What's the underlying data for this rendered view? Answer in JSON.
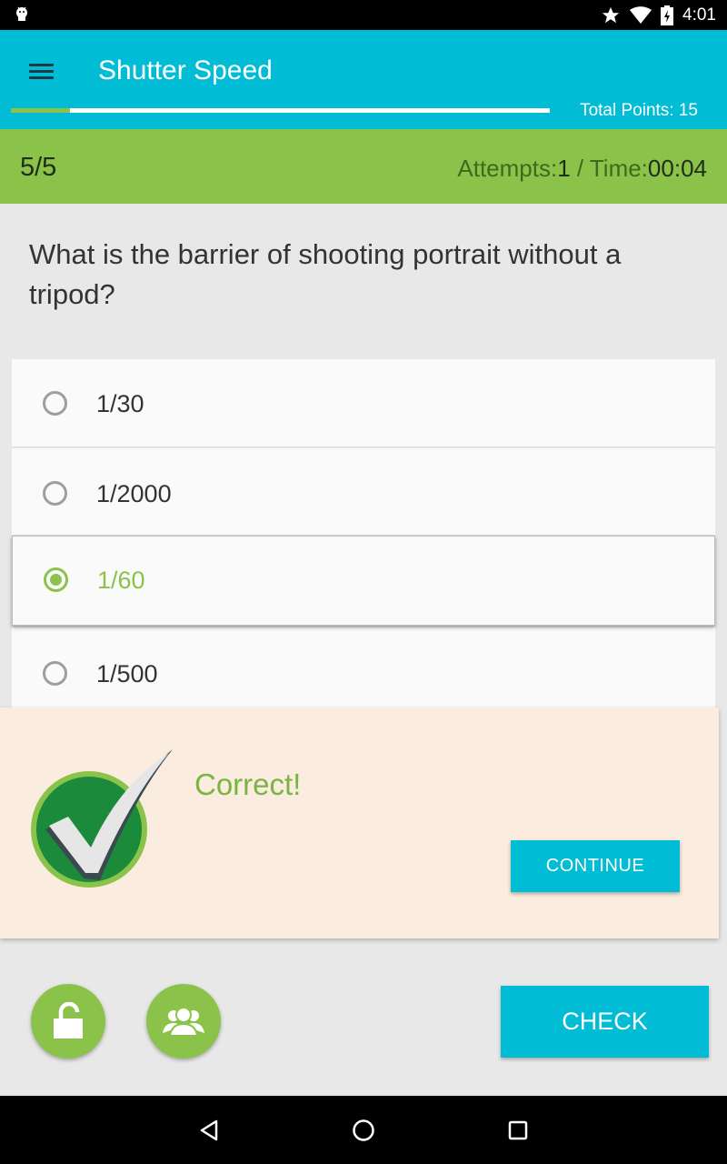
{
  "status_bar": {
    "time": "4:01",
    "icons": [
      "android-icon",
      "star-icon",
      "wifi-icon",
      "battery-icon"
    ]
  },
  "app_bar": {
    "title": "Shutter Speed",
    "total_points_label": "Total Points: 15",
    "progress_fraction": 0.11,
    "color": "#00bcd4"
  },
  "quiz_status": {
    "question_counter": "5/5",
    "attempts_label": "Attempts:",
    "attempts_value": "1",
    "separator": " / ",
    "time_label": "Time:",
    "time_value": "00:04",
    "color": "#8bc34a"
  },
  "question": {
    "text": "What is the barrier of shooting portrait without a tripod?"
  },
  "options": [
    {
      "label": "1/30",
      "selected": false
    },
    {
      "label": "1/2000",
      "selected": false
    },
    {
      "label": "1/60",
      "selected": true
    },
    {
      "label": "1/500",
      "selected": false
    }
  ],
  "feedback": {
    "message": "Correct!",
    "continue_label": "CONTINUE",
    "icon": "checkmark-badge-icon"
  },
  "actions": {
    "hint_icon": "unlock-icon",
    "community_icon": "group-icon",
    "check_label": "CHECK"
  },
  "nav_bar": {
    "icons": [
      "back-icon",
      "home-icon",
      "recents-icon"
    ]
  }
}
